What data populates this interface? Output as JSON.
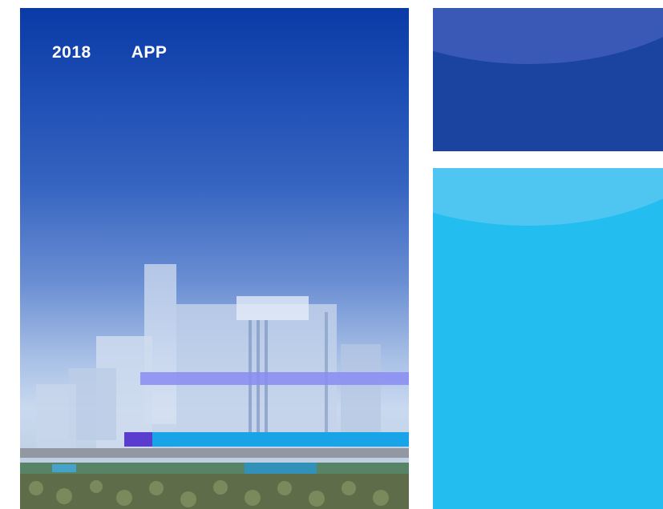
{
  "hero": {
    "year": "2018",
    "label": "APP"
  },
  "colors": {
    "hero_top": "#0a3aa6",
    "card_top": "#1a44a0",
    "card_bottom": "#23bdef"
  }
}
